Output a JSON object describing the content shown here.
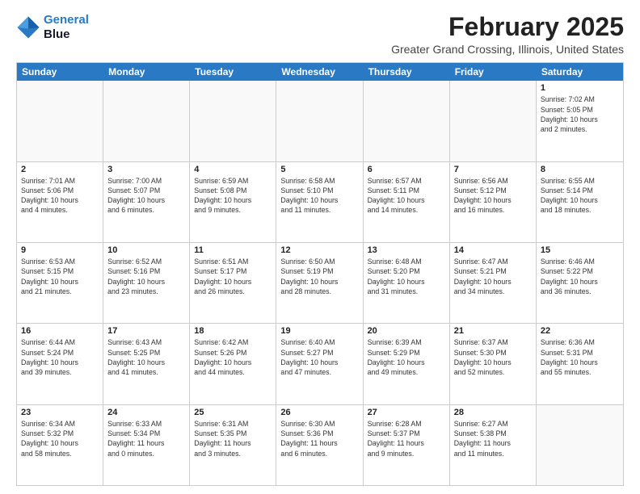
{
  "logo": {
    "line1": "General",
    "line2": "Blue"
  },
  "title": "February 2025",
  "location": "Greater Grand Crossing, Illinois, United States",
  "day_headers": [
    "Sunday",
    "Monday",
    "Tuesday",
    "Wednesday",
    "Thursday",
    "Friday",
    "Saturday"
  ],
  "weeks": [
    [
      {
        "day": "",
        "info": ""
      },
      {
        "day": "",
        "info": ""
      },
      {
        "day": "",
        "info": ""
      },
      {
        "day": "",
        "info": ""
      },
      {
        "day": "",
        "info": ""
      },
      {
        "day": "",
        "info": ""
      },
      {
        "day": "1",
        "info": "Sunrise: 7:02 AM\nSunset: 5:05 PM\nDaylight: 10 hours\nand 2 minutes."
      }
    ],
    [
      {
        "day": "2",
        "info": "Sunrise: 7:01 AM\nSunset: 5:06 PM\nDaylight: 10 hours\nand 4 minutes."
      },
      {
        "day": "3",
        "info": "Sunrise: 7:00 AM\nSunset: 5:07 PM\nDaylight: 10 hours\nand 6 minutes."
      },
      {
        "day": "4",
        "info": "Sunrise: 6:59 AM\nSunset: 5:08 PM\nDaylight: 10 hours\nand 9 minutes."
      },
      {
        "day": "5",
        "info": "Sunrise: 6:58 AM\nSunset: 5:10 PM\nDaylight: 10 hours\nand 11 minutes."
      },
      {
        "day": "6",
        "info": "Sunrise: 6:57 AM\nSunset: 5:11 PM\nDaylight: 10 hours\nand 14 minutes."
      },
      {
        "day": "7",
        "info": "Sunrise: 6:56 AM\nSunset: 5:12 PM\nDaylight: 10 hours\nand 16 minutes."
      },
      {
        "day": "8",
        "info": "Sunrise: 6:55 AM\nSunset: 5:14 PM\nDaylight: 10 hours\nand 18 minutes."
      }
    ],
    [
      {
        "day": "9",
        "info": "Sunrise: 6:53 AM\nSunset: 5:15 PM\nDaylight: 10 hours\nand 21 minutes."
      },
      {
        "day": "10",
        "info": "Sunrise: 6:52 AM\nSunset: 5:16 PM\nDaylight: 10 hours\nand 23 minutes."
      },
      {
        "day": "11",
        "info": "Sunrise: 6:51 AM\nSunset: 5:17 PM\nDaylight: 10 hours\nand 26 minutes."
      },
      {
        "day": "12",
        "info": "Sunrise: 6:50 AM\nSunset: 5:19 PM\nDaylight: 10 hours\nand 28 minutes."
      },
      {
        "day": "13",
        "info": "Sunrise: 6:48 AM\nSunset: 5:20 PM\nDaylight: 10 hours\nand 31 minutes."
      },
      {
        "day": "14",
        "info": "Sunrise: 6:47 AM\nSunset: 5:21 PM\nDaylight: 10 hours\nand 34 minutes."
      },
      {
        "day": "15",
        "info": "Sunrise: 6:46 AM\nSunset: 5:22 PM\nDaylight: 10 hours\nand 36 minutes."
      }
    ],
    [
      {
        "day": "16",
        "info": "Sunrise: 6:44 AM\nSunset: 5:24 PM\nDaylight: 10 hours\nand 39 minutes."
      },
      {
        "day": "17",
        "info": "Sunrise: 6:43 AM\nSunset: 5:25 PM\nDaylight: 10 hours\nand 41 minutes."
      },
      {
        "day": "18",
        "info": "Sunrise: 6:42 AM\nSunset: 5:26 PM\nDaylight: 10 hours\nand 44 minutes."
      },
      {
        "day": "19",
        "info": "Sunrise: 6:40 AM\nSunset: 5:27 PM\nDaylight: 10 hours\nand 47 minutes."
      },
      {
        "day": "20",
        "info": "Sunrise: 6:39 AM\nSunset: 5:29 PM\nDaylight: 10 hours\nand 49 minutes."
      },
      {
        "day": "21",
        "info": "Sunrise: 6:37 AM\nSunset: 5:30 PM\nDaylight: 10 hours\nand 52 minutes."
      },
      {
        "day": "22",
        "info": "Sunrise: 6:36 AM\nSunset: 5:31 PM\nDaylight: 10 hours\nand 55 minutes."
      }
    ],
    [
      {
        "day": "23",
        "info": "Sunrise: 6:34 AM\nSunset: 5:32 PM\nDaylight: 10 hours\nand 58 minutes."
      },
      {
        "day": "24",
        "info": "Sunrise: 6:33 AM\nSunset: 5:34 PM\nDaylight: 11 hours\nand 0 minutes."
      },
      {
        "day": "25",
        "info": "Sunrise: 6:31 AM\nSunset: 5:35 PM\nDaylight: 11 hours\nand 3 minutes."
      },
      {
        "day": "26",
        "info": "Sunrise: 6:30 AM\nSunset: 5:36 PM\nDaylight: 11 hours\nand 6 minutes."
      },
      {
        "day": "27",
        "info": "Sunrise: 6:28 AM\nSunset: 5:37 PM\nDaylight: 11 hours\nand 9 minutes."
      },
      {
        "day": "28",
        "info": "Sunrise: 6:27 AM\nSunset: 5:38 PM\nDaylight: 11 hours\nand 11 minutes."
      },
      {
        "day": "",
        "info": ""
      }
    ]
  ]
}
